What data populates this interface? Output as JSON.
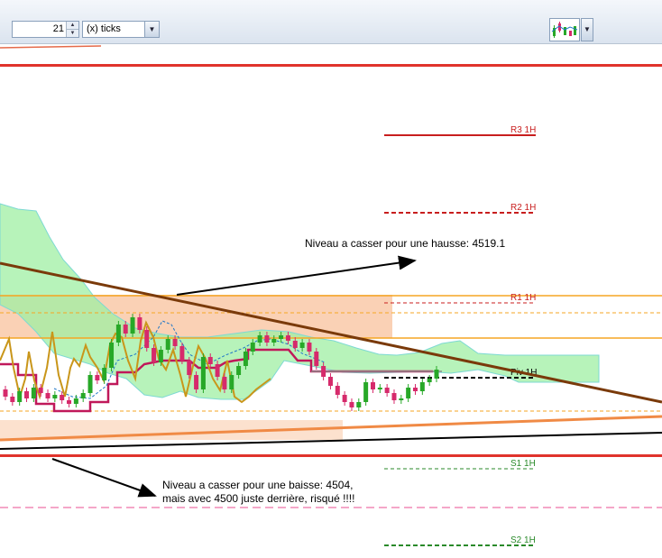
{
  "toolbar": {
    "period_value": "21",
    "period_unit": "(x) ticks",
    "spin_up_icon": "spin-up-icon",
    "spin_down_icon": "spin-down-icon",
    "dropdown_icon": "chevron-down-icon",
    "chart_type_icon": "chart-type-icon"
  },
  "annotations": {
    "upside": "Niveau a casser pour une hausse: 4519.1",
    "downside_line1": "Niveau a casser pour une baisse: 4504,",
    "downside_line2": "mais avec 4500 juste derrière, risqué !!!!"
  },
  "colors": {
    "bull_candle": "#27a827",
    "bear_candle": "#d62a6b",
    "cloud_fill": "#9fefa3",
    "cloud_edge": "#7dd9d3",
    "resistance_trend": "#7a3a0a",
    "support_trend_orange": "#f08a45",
    "support_trend_black": "#000000",
    "support_zone": "#f9c9a8",
    "key_level_red": "#e0332c",
    "pivot_red": "#c81e1e",
    "pivot_green": "#2a8a2a",
    "orange_level": "#f5a623",
    "kijun": "#c0185a",
    "chikou": "#c9961a",
    "tenkan": "#1f77c8"
  },
  "chart_data": {
    "type": "candlestick",
    "title": "",
    "pivot_levels": [
      {
        "label": "R3 1H",
        "color": "#c81e1e",
        "style": "solid"
      },
      {
        "label": "R2 1H",
        "color": "#c81e1e",
        "style": "dashed"
      },
      {
        "label": "R1 1H",
        "color": "#c81e1e",
        "style": "dashed"
      },
      {
        "label": "Piv 1H",
        "color": "#000000",
        "style": "dashed"
      },
      {
        "label": "S1 1H",
        "color": "#2a8a2a",
        "style": "dashed"
      },
      {
        "label": "S2 1H",
        "color": "#2a8a2a",
        "style": "dashed"
      }
    ],
    "key_levels": {
      "upside_break": 4519.1,
      "downside_break": 4504,
      "round_number": 4500
    },
    "candles": [
      {
        "o": 4508.6,
        "c": 4507.8
      },
      {
        "o": 4507.8,
        "c": 4507.2
      },
      {
        "o": 4507.2,
        "c": 4508.4
      },
      {
        "o": 4508.4,
        "c": 4507.6
      },
      {
        "o": 4507.6,
        "c": 4508.8
      },
      {
        "o": 4508.8,
        "c": 4508.2
      },
      {
        "o": 4508.2,
        "c": 4507.6
      },
      {
        "o": 4507.6,
        "c": 4508.0
      },
      {
        "o": 4508.0,
        "c": 4507.4
      },
      {
        "o": 4507.4,
        "c": 4507.0
      },
      {
        "o": 4507.0,
        "c": 4507.6
      },
      {
        "o": 4507.6,
        "c": 4508.2
      },
      {
        "o": 4508.2,
        "c": 4510.2
      },
      {
        "o": 4510.2,
        "c": 4509.6
      },
      {
        "o": 4509.6,
        "c": 4511.0
      },
      {
        "o": 4511.0,
        "c": 4513.8
      },
      {
        "o": 4513.8,
        "c": 4515.8
      },
      {
        "o": 4515.8,
        "c": 4514.8
      },
      {
        "o": 4514.8,
        "c": 4516.6
      },
      {
        "o": 4516.6,
        "c": 4515.2
      },
      {
        "o": 4515.2,
        "c": 4513.2
      },
      {
        "o": 4513.2,
        "c": 4511.6
      },
      {
        "o": 4511.6,
        "c": 4513.0
      },
      {
        "o": 4513.0,
        "c": 4514.2
      },
      {
        "o": 4514.2,
        "c": 4513.4
      },
      {
        "o": 4513.4,
        "c": 4511.8
      },
      {
        "o": 4511.8,
        "c": 4510.2
      },
      {
        "o": 4510.2,
        "c": 4508.6
      },
      {
        "o": 4508.6,
        "c": 4512.2
      },
      {
        "o": 4512.2,
        "c": 4511.4
      },
      {
        "o": 4511.4,
        "c": 4510.0
      },
      {
        "o": 4510.0,
        "c": 4508.6
      },
      {
        "o": 4508.6,
        "c": 4510.2
      },
      {
        "o": 4510.2,
        "c": 4511.2
      },
      {
        "o": 4511.2,
        "c": 4512.8
      },
      {
        "o": 4512.8,
        "c": 4513.8
      },
      {
        "o": 4513.8,
        "c": 4514.6
      },
      {
        "o": 4514.6,
        "c": 4513.8
      },
      {
        "o": 4513.8,
        "c": 4514.2
      },
      {
        "o": 4514.2,
        "c": 4514.6
      },
      {
        "o": 4514.6,
        "c": 4514.0
      },
      {
        "o": 4514.0,
        "c": 4513.2
      },
      {
        "o": 4513.2,
        "c": 4513.8
      },
      {
        "o": 4513.8,
        "c": 4512.8
      },
      {
        "o": 4512.8,
        "c": 4511.2
      },
      {
        "o": 4511.2,
        "c": 4510.0
      },
      {
        "o": 4510.0,
        "c": 4509.0
      },
      {
        "o": 4509.0,
        "c": 4508.0
      },
      {
        "o": 4508.0,
        "c": 4507.2
      },
      {
        "o": 4507.2,
        "c": 4506.6
      },
      {
        "o": 4506.6,
        "c": 4507.2
      },
      {
        "o": 4507.2,
        "c": 4509.4
      },
      {
        "o": 4509.4,
        "c": 4508.6
      },
      {
        "o": 4508.6,
        "c": 4508.8
      },
      {
        "o": 4508.8,
        "c": 4508.2
      },
      {
        "o": 4508.2,
        "c": 4507.4
      },
      {
        "o": 4507.4,
        "c": 4507.6
      },
      {
        "o": 4507.6,
        "c": 4508.8
      },
      {
        "o": 4508.8,
        "c": 4508.4
      },
      {
        "o": 4508.4,
        "c": 4509.4
      },
      {
        "o": 4509.4,
        "c": 4509.8
      },
      {
        "o": 4509.8,
        "c": 4510.8
      }
    ]
  }
}
